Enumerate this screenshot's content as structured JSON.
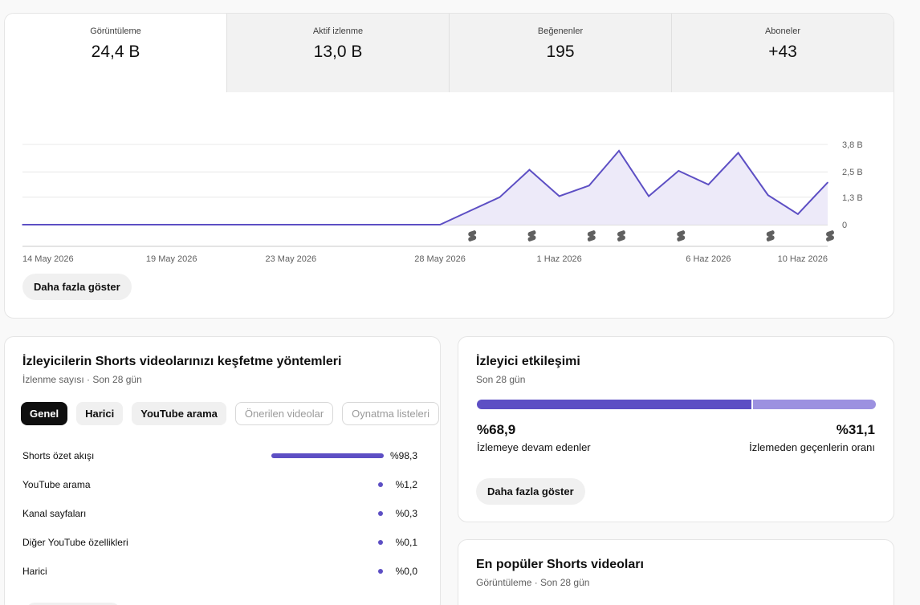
{
  "overview": {
    "metrics": [
      {
        "label": "Görüntüleme",
        "value": "24,4 B"
      },
      {
        "label": "Aktif izlenme",
        "value": "13,0 B"
      },
      {
        "label": "Beğenenler",
        "value": "195"
      },
      {
        "label": "Aboneler",
        "value": "+43"
      }
    ],
    "more_label": "Daha fazla göster"
  },
  "chart_data": {
    "type": "area",
    "title": "",
    "xlabel": "",
    "ylabel": "",
    "x_tick_labels": [
      "14 May 2026",
      "19 May 2026",
      "23 May 2026",
      "28 May 2026",
      "1 Haz 2026",
      "6 Haz 2026",
      "10 Haz 2026"
    ],
    "y_tick_labels": [
      "0",
      "1,3 B",
      "2,5 B",
      "3,8 B"
    ],
    "y_ticks": [
      0,
      1.3,
      2.5,
      3.8
    ],
    "ylim": [
      0,
      3.8
    ],
    "series": [
      {
        "color": "#5d4fc4",
        "x": [
          "14 May",
          "15 May",
          "16 May",
          "17 May",
          "18 May",
          "19 May",
          "20 May",
          "21 May",
          "22 May",
          "23 May",
          "24 May",
          "25 May",
          "26 May",
          "27 May",
          "28 May",
          "29 May",
          "30 May",
          "31 May",
          "1 Haz",
          "2 Haz",
          "3 Haz",
          "4 Haz",
          "5 Haz",
          "6 Haz",
          "7 Haz",
          "8 Haz",
          "9 Haz",
          "10 Haz"
        ],
        "values": [
          0,
          0,
          0,
          0,
          0,
          0,
          0,
          0,
          0,
          0,
          0,
          0,
          0,
          0,
          0,
          0.65,
          1.3,
          2.6,
          1.35,
          1.85,
          3.5,
          1.35,
          2.55,
          1.9,
          3.4,
          1.4,
          0.5,
          2.0
        ]
      }
    ],
    "shorts_markers_at": [
      "29 May",
      "31 May",
      "2 Haz",
      "3 Haz",
      "5 Haz",
      "8 Haz",
      "10 Haz"
    ],
    "grid": true
  },
  "discovery": {
    "title": "İzleyicilerin Shorts videolarınızı keşfetme yöntemleri",
    "subtitle": "İzlenme sayısı · Son 28 gün",
    "chips": [
      {
        "label": "Genel",
        "state": "selected"
      },
      {
        "label": "Harici",
        "state": "normal"
      },
      {
        "label": "YouTube arama",
        "state": "normal"
      },
      {
        "label": "Önerilen videolar",
        "state": "disabled"
      },
      {
        "label": "Oynatma listeleri",
        "state": "disabled"
      }
    ],
    "sources": [
      {
        "label": "Shorts özet akışı",
        "value": "%98,3",
        "share": 0.983
      },
      {
        "label": "YouTube arama",
        "value": "%1,2",
        "share": 0.012
      },
      {
        "label": "Kanal sayfaları",
        "value": "%0,3",
        "share": 0.003
      },
      {
        "label": "Diğer YouTube özellikleri",
        "value": "%0,1",
        "share": 0.001
      },
      {
        "label": "Harici",
        "value": "%0,0",
        "share": 0.0
      }
    ]
  },
  "engagement": {
    "title": "İzleyici etkileşimi",
    "subtitle": "Son 28 gün",
    "stay_value": "%68,9",
    "stay_label": "İzlemeye devam edenler",
    "stay_share": 0.689,
    "skip_value": "%31,1",
    "skip_label": "İzlemeden geçenlerin oranı",
    "more_label": "Daha fazla göster",
    "colors": {
      "stay": "#5d4fc4",
      "skip": "#9c91e0"
    }
  },
  "popular": {
    "title": "En popüler Shorts videoları",
    "subtitle": "Görüntüleme · Son 28 gün"
  }
}
